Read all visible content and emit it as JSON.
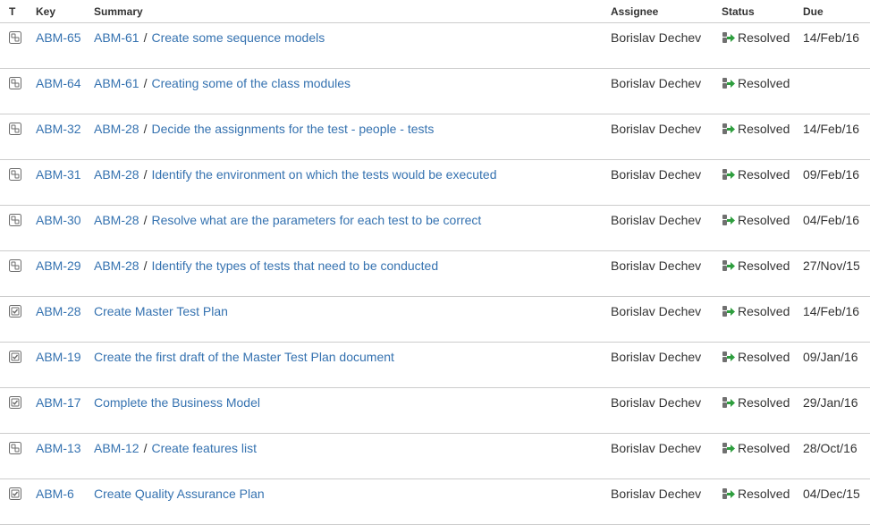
{
  "columns": {
    "type": "T",
    "key": "Key",
    "summary": "Summary",
    "assignee": "Assignee",
    "status": "Status",
    "due": "Due"
  },
  "rows": [
    {
      "type_icon": "subtask-icon",
      "key": "ABM-65",
      "parent": "ABM-61",
      "summary": "Create some sequence models",
      "assignee": "Borislav Dechev",
      "status": "Resolved",
      "due": "14/Feb/16"
    },
    {
      "type_icon": "subtask-icon",
      "key": "ABM-64",
      "parent": "ABM-61",
      "summary": "Creating some of the class modules",
      "assignee": "Borislav Dechev",
      "status": "Resolved",
      "due": ""
    },
    {
      "type_icon": "subtask-icon",
      "key": "ABM-32",
      "parent": "ABM-28",
      "summary": "Decide the assignments for the test - people - tests",
      "assignee": "Borislav Dechev",
      "status": "Resolved",
      "due": "14/Feb/16"
    },
    {
      "type_icon": "subtask-icon",
      "key": "ABM-31",
      "parent": "ABM-28",
      "summary": "Identify the environment on which the tests would be executed",
      "assignee": "Borislav Dechev",
      "status": "Resolved",
      "due": "09/Feb/16"
    },
    {
      "type_icon": "subtask-icon",
      "key": "ABM-30",
      "parent": "ABM-28",
      "summary": "Resolve what are the parameters for each test to be correct",
      "assignee": "Borislav Dechev",
      "status": "Resolved",
      "due": "04/Feb/16"
    },
    {
      "type_icon": "subtask-icon",
      "key": "ABM-29",
      "parent": "ABM-28",
      "summary": "Identify the types of tests that need to be conducted",
      "assignee": "Borislav Dechev",
      "status": "Resolved",
      "due": "27/Nov/15"
    },
    {
      "type_icon": "task-icon",
      "key": "ABM-28",
      "parent": "",
      "summary": "Create Master Test Plan",
      "assignee": "Borislav Dechev",
      "status": "Resolved",
      "due": "14/Feb/16"
    },
    {
      "type_icon": "task-icon",
      "key": "ABM-19",
      "parent": "",
      "summary": "Create the first draft of the Master Test Plan document",
      "assignee": "Borislav Dechev",
      "status": "Resolved",
      "due": "09/Jan/16"
    },
    {
      "type_icon": "task-icon",
      "key": "ABM-17",
      "parent": "",
      "summary": "Complete the Business Model",
      "assignee": "Borislav Dechev",
      "status": "Resolved",
      "due": "29/Jan/16"
    },
    {
      "type_icon": "subtask-icon",
      "key": "ABM-13",
      "parent": "ABM-12",
      "summary": "Create features list",
      "assignee": "Borislav Dechev",
      "status": "Resolved",
      "due": "28/Oct/16"
    },
    {
      "type_icon": "task-icon",
      "key": "ABM-6",
      "parent": "",
      "summary": "Create Quality Assurance Plan",
      "assignee": "Borislav Dechev",
      "status": "Resolved",
      "due": "04/Dec/15"
    }
  ],
  "colors": {
    "link": "#3572b0",
    "text": "#333333",
    "border": "#cccccc",
    "status_arrow": "#2e9e3e",
    "status_icon": "#707070"
  }
}
